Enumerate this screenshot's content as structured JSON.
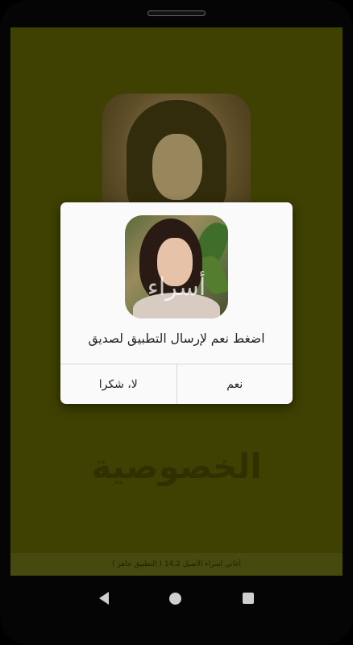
{
  "app": {
    "background_title": "الخصوصية",
    "footer_text": "أغاني اسراء الأصيل 14.2 ( التطبيق جاهز )"
  },
  "dialog": {
    "icon_signature": "أسراء",
    "message": "اضغط نعم لإرسال التطبيق لصديق",
    "no_label": "لا، شكرا",
    "yes_label": "نعم"
  },
  "navbar": {
    "back_icon": "back-icon",
    "home_icon": "home-icon",
    "recents_icon": "recents-icon"
  },
  "colors": {
    "screen_bg": "#3f4102",
    "dialog_bg": "#fafafa"
  }
}
